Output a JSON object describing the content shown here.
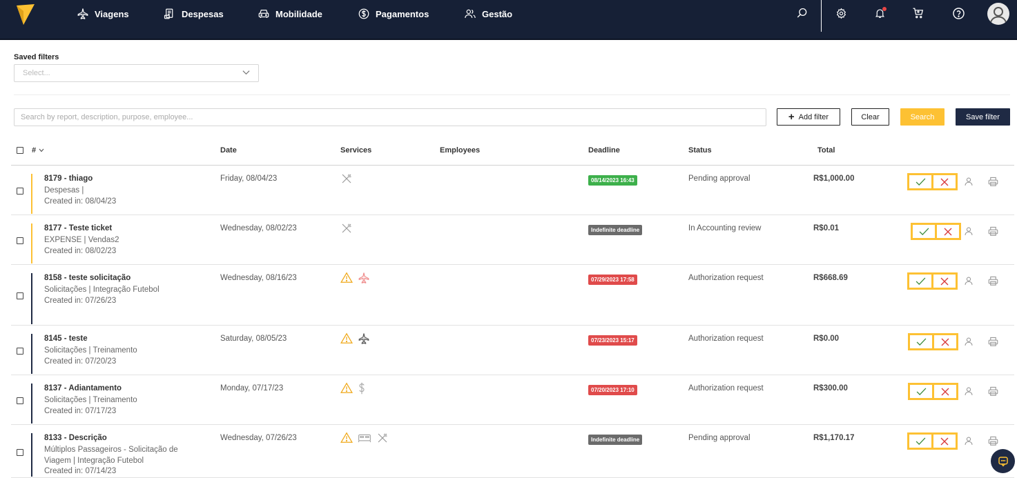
{
  "nav": {
    "items": [
      {
        "label": "Viagens",
        "icon": "plane-icon"
      },
      {
        "label": "Despesas",
        "icon": "receipt-icon"
      },
      {
        "label": "Mobilidade",
        "icon": "car-icon"
      },
      {
        "label": "Pagamentos",
        "icon": "dollar-circle-icon"
      },
      {
        "label": "Gestão",
        "icon": "users-icon"
      }
    ],
    "accent_color": "#fdc133",
    "background_color": "#162036"
  },
  "saved_filters": {
    "label": "Saved filters",
    "placeholder": "Select..."
  },
  "search": {
    "placeholder": "Search by report, description, purpose, employee...",
    "add_filter_label": "Add filter",
    "clear_label": "Clear",
    "search_label": "Search",
    "save_filter_label": "Save filter"
  },
  "table": {
    "columns": {
      "number": "#",
      "date": "Date",
      "services": "Services",
      "employees": "Employees",
      "deadline": "Deadline",
      "status": "Status",
      "total": "Total"
    },
    "rows": [
      {
        "title": "8179 - thiago",
        "subtitle": "Despesas |",
        "created": "Created in: 08/04/23",
        "date": "Friday, 08/04/23",
        "services": [
          "cutlery-icon"
        ],
        "deadline": "08/14/2023 16:43",
        "deadline_color": "green",
        "status": "Pending approval",
        "total": "R$1,000.00",
        "bar_color": "#fdc133"
      },
      {
        "title": "8177 - Teste ticket",
        "subtitle": "EXPENSE | Vendas2",
        "created": "Created in: 08/02/23",
        "date": "Wednesday, 08/02/23",
        "services": [
          "cutlery-icon"
        ],
        "deadline": "Indefinite deadline",
        "deadline_color": "gray",
        "status": "In Accounting review",
        "total": "R$0.01",
        "bar_color": "#fdc133"
      },
      {
        "title": "8158 - teste solicitação",
        "subtitle": "Solicitações | Integração Futebol",
        "created": "Created in: 07/26/23",
        "date": "Wednesday, 08/16/23",
        "services": [
          "warning-icon",
          "plane-icon-red"
        ],
        "deadline": "07/29/2023 17:58",
        "deadline_color": "red",
        "status": "Authorization request",
        "total": "R$668.69",
        "bar_color": "#1f2a44"
      },
      {
        "title": "8145 - teste",
        "subtitle": "Solicitações | Treinamento",
        "created": "Created in: 07/20/23",
        "date": "Saturday, 08/05/23",
        "services": [
          "warning-icon",
          "plane-icon"
        ],
        "deadline": "07/23/2023 15:17",
        "deadline_color": "red",
        "status": "Authorization request",
        "total": "R$0.00",
        "bar_color": "#1f2a44"
      },
      {
        "title": "8137 - Adiantamento",
        "subtitle": "Solicitações | Treinamento",
        "created": "Created in: 07/17/23",
        "date": "Monday, 07/17/23",
        "services": [
          "warning-icon",
          "dollar-icon"
        ],
        "deadline": "07/20/2023 17:10",
        "deadline_color": "red",
        "status": "Authorization request",
        "total": "R$300.00",
        "bar_color": "#1f2a44"
      },
      {
        "title": "8133 - Descrição",
        "subtitle": "Múltiplos Passageiros - Solicitação de Viagem | Integração Futebol",
        "created": "Created in: 07/14/23",
        "date": "Wednesday, 07/26/23",
        "services": [
          "warning-icon",
          "bed-icon",
          "cutlery-icon"
        ],
        "deadline": "Indefinite deadline",
        "deadline_color": "gray",
        "status": "Pending approval",
        "total": "R$1,170.17",
        "bar_color": "#1f2a44"
      }
    ]
  }
}
